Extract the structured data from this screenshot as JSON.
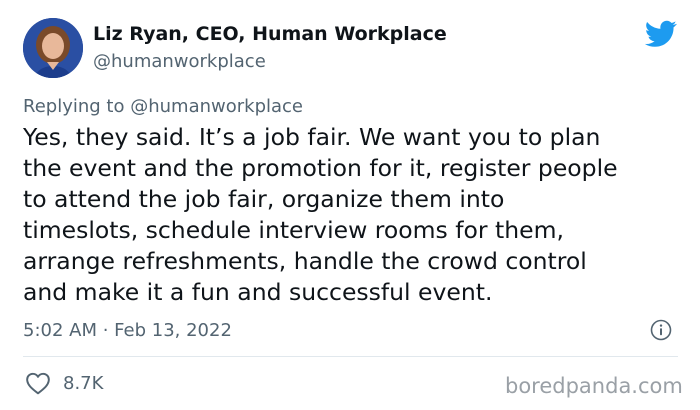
{
  "author": {
    "name": "Liz Ryan, CEO, Human Workplace",
    "handle": "@humanworkplace",
    "avatar_icon": "profile-photo"
  },
  "reply": {
    "prefix": "Replying to",
    "mention": "@humanworkplace"
  },
  "tweet": {
    "lines": [
      "Yes, they said. It’s a job fair. We want you to plan",
      "the event and the promotion for it, register people",
      "to attend the job fair, organize them into",
      "timeslots, schedule interview rooms for them,",
      "arrange refreshments, handle the crowd control",
      "and make it a fun and successful event."
    ],
    "timestamp": "5:02 AM · Feb 13, 2022"
  },
  "actions": {
    "like_count": "8.7K",
    "like_icon": "heart-icon",
    "info_icon": "info-icon"
  },
  "branding": {
    "platform_icon": "twitter-bird-icon",
    "platform_color": "#1d9bf0",
    "watermark": "boredpanda.com"
  },
  "colors": {
    "text": "#0f1419",
    "secondary": "#536471",
    "divider": "#e1e8ed"
  }
}
